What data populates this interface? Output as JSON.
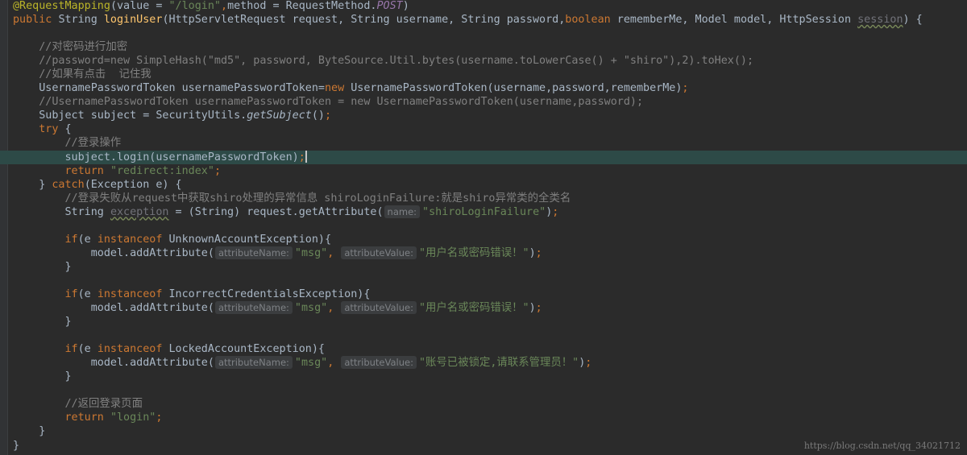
{
  "editor": {
    "theme_colors": {
      "background": "#2b2b2b",
      "keyword": "#cc7832",
      "annotation": "#bbb529",
      "string": "#6a8759",
      "comment": "#808080",
      "method_decl": "#ffc66d",
      "constant": "#9876aa",
      "current_line": "#2d4a47"
    },
    "watermark": "https://blog.csdn.net/qq_34021712"
  },
  "code": {
    "l1": {
      "a": "@RequestMapping",
      "b": "(value = ",
      "c": "\"/login\"",
      "d": ",",
      "e": "method",
      "f": " = RequestMethod.",
      "g": "POST",
      "h": ")"
    },
    "l2": {
      "a": "public ",
      "b": "String ",
      "c": "loginUser",
      "d": "(HttpServletRequest request, String username, String password,",
      "e": "boolean ",
      "f": "rememberMe, Model model, HttpSession ",
      "g": "session",
      "h": ") {"
    },
    "l4": "//对密码进行加密",
    "l5": "//password=new SimpleHash(\"md5\", password, ByteSource.Util.bytes(username.toLowerCase() + \"shiro\"),2).toHex();",
    "l6": "//如果有点击  记住我",
    "l7": {
      "a": "UsernamePasswordToken usernamePasswordToken=",
      "b": "new ",
      "c": "UsernamePasswordToken(username,password,rememberMe)",
      "d": ";"
    },
    "l8": "//UsernamePasswordToken usernamePasswordToken = new UsernamePasswordToken(username,password);",
    "l9": {
      "a": "Subject subject = SecurityUtils.",
      "b": "getSubject",
      "c": "()",
      "d": ";"
    },
    "l10": {
      "a": "try ",
      "b": "{"
    },
    "l11": "//登录操作",
    "l12": {
      "a": "subject.login(usernamePasswordToken)",
      "b": ";"
    },
    "l13": {
      "a": "return ",
      "b": "\"redirect:index\"",
      "c": ";"
    },
    "l14": {
      "a": "} ",
      "b": "catch",
      "c": "(Exception e) {"
    },
    "l15": "//登录失败从request中获取shiro处理的异常信息 shiroLoginFailure:就是shiro异常类的全类名",
    "l16": {
      "a": "String ",
      "b": "exception",
      "c": " = (String) request.getAttribute(",
      "hint": "name:",
      "d": "\"shiroLoginFailure\"",
      "e": ")",
      "f": ";"
    },
    "l18": {
      "a": "if",
      "b": "(e ",
      "c": "instanceof ",
      "d": "UnknownAccountException){"
    },
    "l19": {
      "a": "model.addAttribute(",
      "h1": "attributeName:",
      "s1": "\"msg\"",
      "comma": ", ",
      "h2": "attributeValue:",
      "s2": "\"用户名或密码错误！\"",
      "end": ")",
      "semi": ";"
    },
    "l20": "}",
    "l22": {
      "a": "if",
      "b": "(e ",
      "c": "instanceof ",
      "d": "IncorrectCredentialsException){"
    },
    "l23": {
      "a": "model.addAttribute(",
      "h1": "attributeName:",
      "s1": "\"msg\"",
      "comma": ", ",
      "h2": "attributeValue:",
      "s2": "\"用户名或密码错误！\"",
      "end": ")",
      "semi": ";"
    },
    "l24": "}",
    "l26": {
      "a": "if",
      "b": "(e ",
      "c": "instanceof ",
      "d": "LockedAccountException){"
    },
    "l27": {
      "a": "model.addAttribute(",
      "h1": "attributeName:",
      "s1": "\"msg\"",
      "comma": ", ",
      "h2": "attributeValue:",
      "s2": "\"账号已被锁定,请联系管理员！\"",
      "end": ")",
      "semi": ";"
    },
    "l28": "}",
    "l30": "//返回登录页面",
    "l31": {
      "a": "return ",
      "b": "\"login\"",
      "c": ";"
    },
    "l32": "}",
    "l33": "}"
  }
}
